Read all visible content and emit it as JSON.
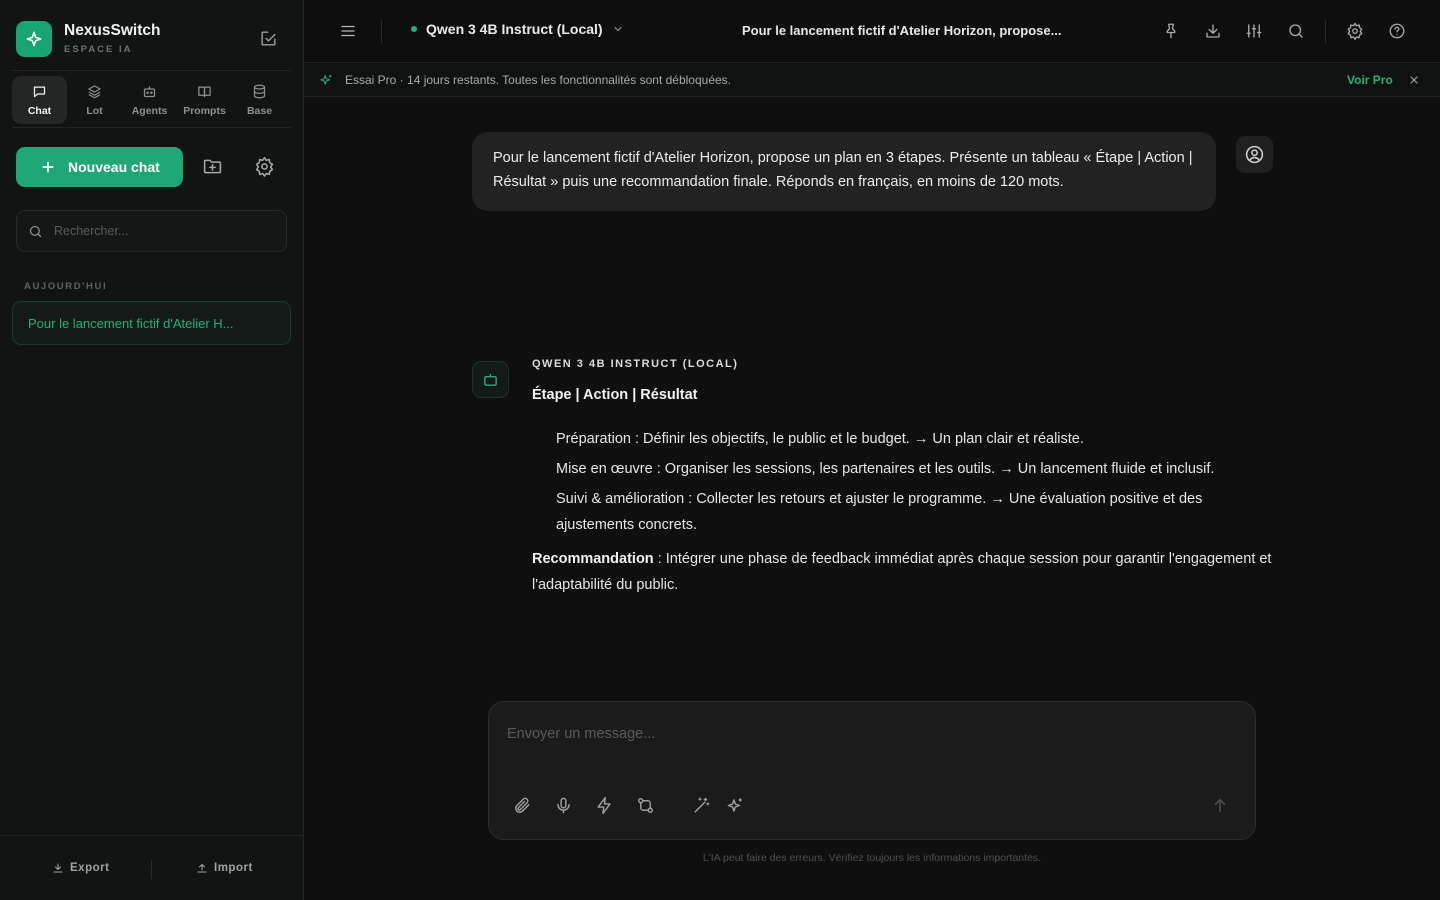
{
  "brand": {
    "name": "NexusSwitch",
    "subtitle": "ESPACE IA",
    "logo_icon": "sparkle-icon",
    "accent": "#1ea876"
  },
  "nav_tabs": [
    {
      "label": "Chat",
      "icon": "chat-bubble-icon",
      "active": true
    },
    {
      "label": "Lot",
      "icon": "layers-icon",
      "active": false
    },
    {
      "label": "Agents",
      "icon": "robot-icon",
      "active": false
    },
    {
      "label": "Prompts",
      "icon": "book-icon",
      "active": false
    },
    {
      "label": "Base",
      "icon": "database-icon",
      "active": false
    }
  ],
  "sidebar": {
    "new_chat_label": "Nouveau chat",
    "search_placeholder": "Rechercher...",
    "section_today": "AUJOURD'HUI",
    "conversations": [
      {
        "title": "Pour le lancement fictif d'Atelier H...",
        "active": true
      }
    ],
    "export_label": "Export",
    "import_label": "Import"
  },
  "topbar": {
    "model_name": "Qwen 3 4B Instruct (Local)",
    "model_status_color": "#21b27d",
    "conversation_title": "Pour le lancement fictif d'Atelier Horizon, propose..."
  },
  "banner": {
    "text": "Essai Pro · 14 jours restants. Toutes les fonctionnalités sont débloquées.",
    "link_label": "Voir Pro"
  },
  "messages": {
    "user_text": "Pour le lancement fictif d'Atelier Horizon, propose un plan en 3 étapes. Présente un tableau « Étape | Action | Résultat » puis une recommandation finale. Réponds en français, en moins de 120 mots.",
    "bot_name": "QWEN 3 4B INSTRUCT (LOCAL)",
    "bot_heading": "Étape | Action | Résultat",
    "bot_steps": [
      "Préparation : Définir les objectifs, le public et le budget. → Un plan clair et réaliste.",
      "Mise en œuvre : Organiser les sessions, les partenaires et les outils. → Un lancement fluide et inclusif.",
      "Suivi & amélioration : Collecter les retours et ajuster le programme. → Une évaluation positive et des ajustements concrets."
    ],
    "bot_reco_label": "Recommandation",
    "bot_reco_text": " : Intégrer une phase de feedback immédiat après chaque session pour garantir l'engagement et l'adaptabilité du public."
  },
  "composer": {
    "placeholder": "Envoyer un message...",
    "disclaimer": "L'IA peut faire des erreurs. Vérifiez toujours les informations importantes."
  }
}
